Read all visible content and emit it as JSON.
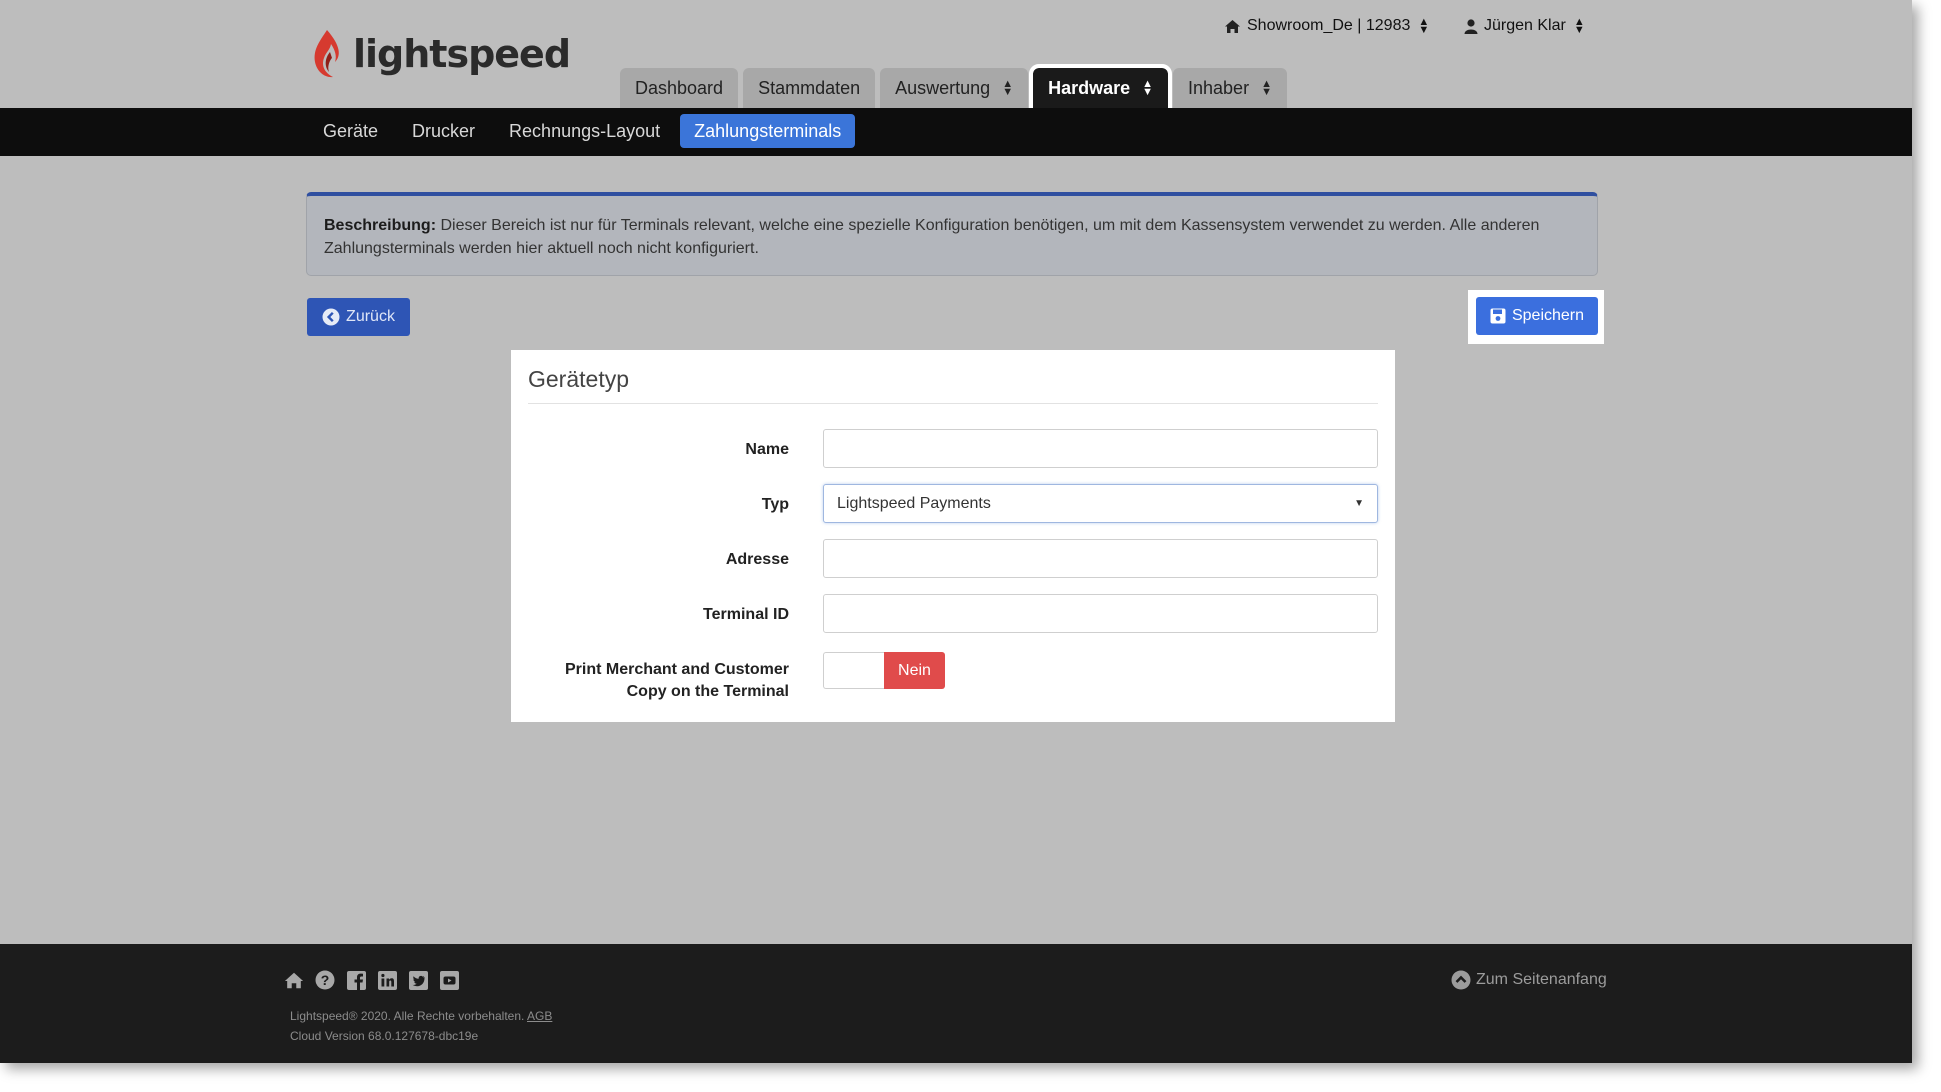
{
  "logo": {
    "text": "lightspeed"
  },
  "topbar": {
    "store": "Showroom_De | 12983",
    "user": "Jürgen Klar"
  },
  "main_tabs": [
    {
      "label": "Dashboard",
      "has_sort": false,
      "active": false
    },
    {
      "label": "Stammdaten",
      "has_sort": false,
      "active": false
    },
    {
      "label": "Auswertung",
      "has_sort": true,
      "active": false
    },
    {
      "label": "Hardware",
      "has_sort": true,
      "active": true
    },
    {
      "label": "Inhaber",
      "has_sort": true,
      "active": false
    }
  ],
  "sub_nav": [
    {
      "label": "Geräte",
      "active": false
    },
    {
      "label": "Drucker",
      "active": false
    },
    {
      "label": "Rechnungs-Layout",
      "active": false
    },
    {
      "label": "Zahlungsterminals",
      "active": true
    }
  ],
  "description": {
    "label": "Beschreibung:",
    "text": "Dieser Bereich ist nur für Terminals relevant, welche eine spezielle Konfiguration benötigen, um mit dem Kassensystem verwendet zu werden. Alle anderen Zahlungsterminals werden hier aktuell noch nicht konfiguriert."
  },
  "buttons": {
    "back": "Zurück",
    "save": "Speichern"
  },
  "form": {
    "title": "Gerätetyp",
    "name_label": "Name",
    "name_value": "",
    "type_label": "Typ",
    "type_value": "Lightspeed Payments",
    "address_label": "Adresse",
    "address_value": "",
    "terminal_label": "Terminal ID",
    "terminal_value": "",
    "print_label_line1": "Print Merchant and Customer",
    "print_label_line2": "Copy on the Terminal",
    "print_toggle": "Nein"
  },
  "footer": {
    "copyright": "Lightspeed® 2020. Alle Rechte vorbehalten.",
    "agb": "AGB",
    "version": "Cloud Version 68.0.127678-dbc19e",
    "to_top": "Zum Seitenanfang"
  },
  "colors": {
    "brand_red": "#e03c31",
    "active_blue": "#3b75d9",
    "toggle_no": "#e04b4b"
  }
}
